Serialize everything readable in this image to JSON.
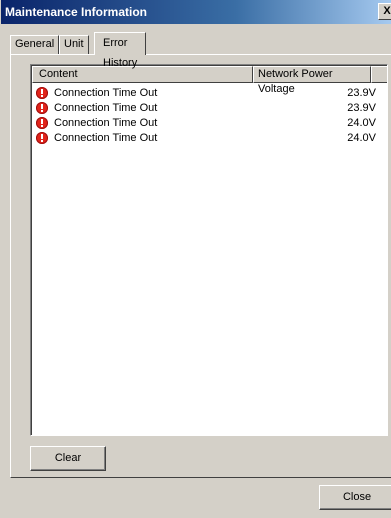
{
  "window": {
    "title": "Maintenance Information",
    "close_glyph": "X"
  },
  "tabs": [
    {
      "label": "General",
      "active": false
    },
    {
      "label": "Unit",
      "active": false
    },
    {
      "label": "Error History",
      "active": true
    }
  ],
  "list": {
    "columns": {
      "content": "Content",
      "voltage": "Network Power Voltage"
    },
    "rows": [
      {
        "icon": "error-icon",
        "content": "Connection Time Out",
        "voltage": "23.9V"
      },
      {
        "icon": "error-icon",
        "content": "Connection Time Out",
        "voltage": "23.9V"
      },
      {
        "icon": "error-icon",
        "content": "Connection Time Out",
        "voltage": "24.0V"
      },
      {
        "icon": "error-icon",
        "content": "Connection Time Out",
        "voltage": "24.0V"
      }
    ]
  },
  "buttons": {
    "clear": "Clear",
    "close": "Close"
  },
  "colors": {
    "error": "#e2231a",
    "titlebar": "#0a246a",
    "face": "#d4d0c8"
  }
}
